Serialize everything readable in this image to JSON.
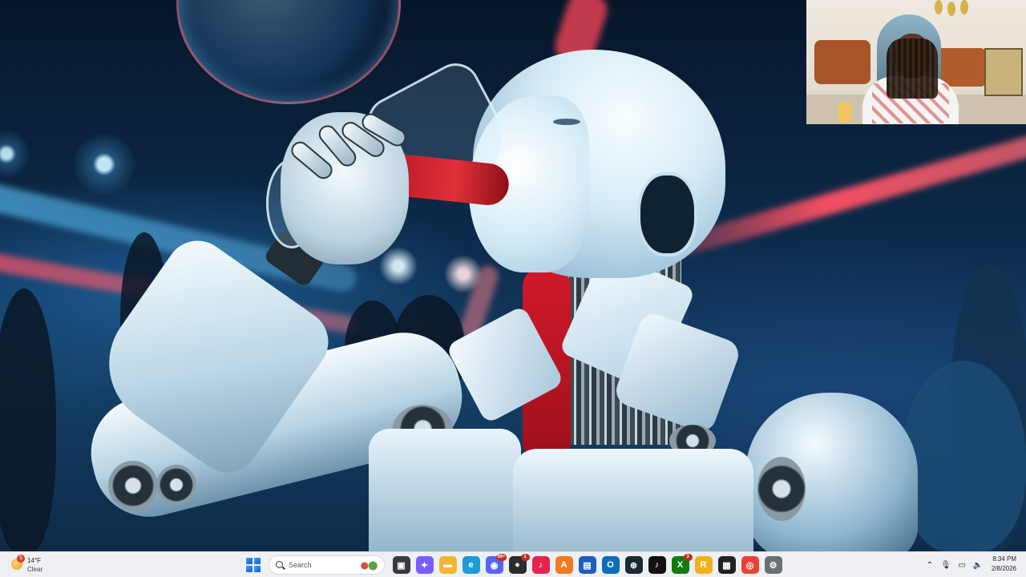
{
  "taskbar": {
    "weather": {
      "temperature": "14°F",
      "condition": "Clear",
      "badge": "5",
      "icon": "sun-icon"
    },
    "search": {
      "placeholder": "Search"
    },
    "apps": [
      {
        "name": "task-view",
        "icon": "task-view-icon",
        "color": "#3a3a3a"
      },
      {
        "name": "copilot",
        "icon": "copilot-icon",
        "color": "#7a5cff"
      },
      {
        "name": "file-explorer",
        "icon": "folder-icon",
        "color": "#f2b632"
      },
      {
        "name": "edge",
        "icon": "edge-icon",
        "color": "#1f9bd6"
      },
      {
        "name": "discord",
        "icon": "discord-icon",
        "color": "#5865f2",
        "badge": "99+"
      },
      {
        "name": "app-chat",
        "icon": "chat-app-icon",
        "color": "#2b2b2b",
        "badge": "1"
      },
      {
        "name": "tiktok-live",
        "icon": "tiktok-live-icon",
        "color": "#e4244f"
      },
      {
        "name": "app-orange",
        "icon": "a-app-icon",
        "color": "#f07a22"
      },
      {
        "name": "app-store",
        "icon": "store-icon",
        "color": "#1c5fbd"
      },
      {
        "name": "outlook",
        "icon": "outlook-icon",
        "color": "#0f6cbd"
      },
      {
        "name": "steam",
        "icon": "steam-icon",
        "color": "#1b2838"
      },
      {
        "name": "tiktok",
        "icon": "tiktok-icon",
        "color": "#111111"
      },
      {
        "name": "xbox",
        "icon": "xbox-icon",
        "color": "#107c10",
        "badge": "3"
      },
      {
        "name": "rockstar",
        "icon": "rockstar-icon",
        "color": "#f2b01e"
      },
      {
        "name": "stream-app",
        "icon": "stream-app-icon",
        "color": "#222222"
      },
      {
        "name": "chrome",
        "icon": "chrome-icon",
        "color": "#e94235"
      },
      {
        "name": "settings",
        "icon": "gear-icon",
        "color": "#6b6f76"
      }
    ],
    "tray": [
      "chevron-up-icon",
      "microphone-icon",
      "display-icon",
      "speaker-icon"
    ],
    "clock": {
      "time": "8:34 PM",
      "date": "2/8/2026"
    }
  }
}
